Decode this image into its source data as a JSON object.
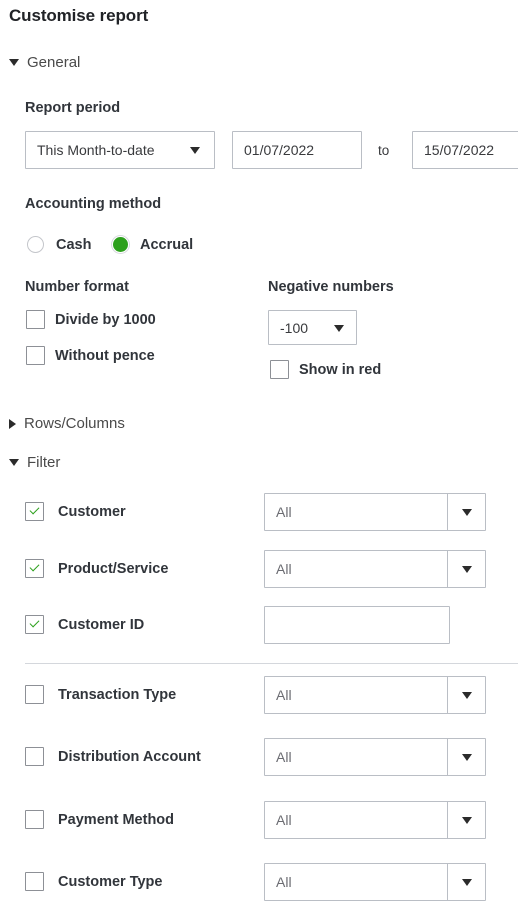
{
  "title": "Customise report",
  "sections": {
    "general": {
      "label": "General",
      "expanded": true
    },
    "rows_columns": {
      "label": "Rows/Columns",
      "expanded": false
    },
    "filter": {
      "label": "Filter",
      "expanded": true
    }
  },
  "report_period": {
    "label": "Report period",
    "preset": "This Month-to-date",
    "start_date": "01/07/2022",
    "to_word": "to",
    "end_date": "15/07/2022"
  },
  "accounting_method": {
    "label": "Accounting method",
    "options": [
      {
        "label": "Cash",
        "selected": false
      },
      {
        "label": "Accrual",
        "selected": true
      }
    ]
  },
  "number_format": {
    "label": "Number format",
    "options": [
      {
        "label": "Divide by 1000",
        "checked": false
      },
      {
        "label": "Without pence",
        "checked": false
      }
    ]
  },
  "negative_numbers": {
    "label": "Negative numbers",
    "value": "-100",
    "show_in_red": {
      "label": "Show in red",
      "checked": false
    }
  },
  "filters": [
    {
      "label": "Customer",
      "checked": true,
      "value": "All",
      "control": "dropdown"
    },
    {
      "label": "Product/Service",
      "checked": true,
      "value": "All",
      "control": "dropdown"
    },
    {
      "label": "Customer ID",
      "checked": true,
      "value": "",
      "control": "text"
    },
    {
      "label": "Transaction Type",
      "checked": false,
      "value": "All",
      "control": "dropdown"
    },
    {
      "label": "Distribution Account",
      "checked": false,
      "value": "All",
      "control": "dropdown"
    },
    {
      "label": "Payment Method",
      "checked": false,
      "value": "All",
      "control": "dropdown"
    },
    {
      "label": "Customer Type",
      "checked": false,
      "value": "All",
      "control": "dropdown"
    }
  ],
  "colors": {
    "accent_green": "#2CA01C",
    "text": "#393A3D",
    "border": "#BABEC5"
  }
}
